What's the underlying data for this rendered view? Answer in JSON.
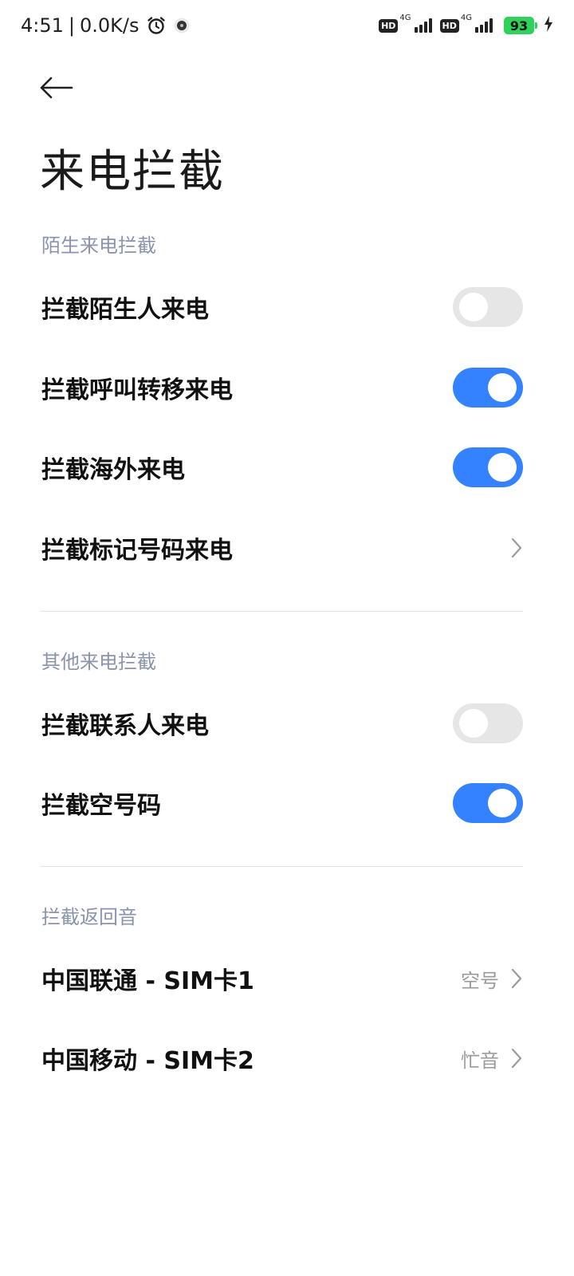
{
  "status_bar": {
    "time": "4:51",
    "separator": "|",
    "net_speed": "0.0K/s",
    "hd1": "HD",
    "net1": "4G",
    "hd2": "HD",
    "net2": "4G",
    "battery": "93",
    "icons": [
      "alarm-icon",
      "notification-dot-icon",
      "signal-icon",
      "charging-bolt-icon"
    ]
  },
  "header": {
    "back_icon": "back-arrow-icon",
    "title": "来电拦截"
  },
  "sections": {
    "stranger": {
      "label": "陌生来电拦截",
      "items": [
        {
          "label": "拦截陌生人来电",
          "type": "toggle",
          "on": false
        },
        {
          "label": "拦截呼叫转移来电",
          "type": "toggle",
          "on": true
        },
        {
          "label": "拦截海外来电",
          "type": "toggle",
          "on": true
        },
        {
          "label": "拦截标记号码来电",
          "type": "link"
        }
      ]
    },
    "other": {
      "label": "其他来电拦截",
      "items": [
        {
          "label": "拦截联系人来电",
          "type": "toggle",
          "on": false
        },
        {
          "label": "拦截空号码",
          "type": "toggle",
          "on": true
        }
      ]
    },
    "tone": {
      "label": "拦截返回音",
      "items": [
        {
          "label": "中国联通 - SIM卡1",
          "value": "空号"
        },
        {
          "label": "中国移动 - SIM卡2",
          "value": "忙音"
        }
      ]
    }
  },
  "colors": {
    "accent": "#3482ff",
    "toggle_off": "#e6e6e6",
    "section_label": "#8a93ad",
    "battery": "#2fd15a"
  }
}
